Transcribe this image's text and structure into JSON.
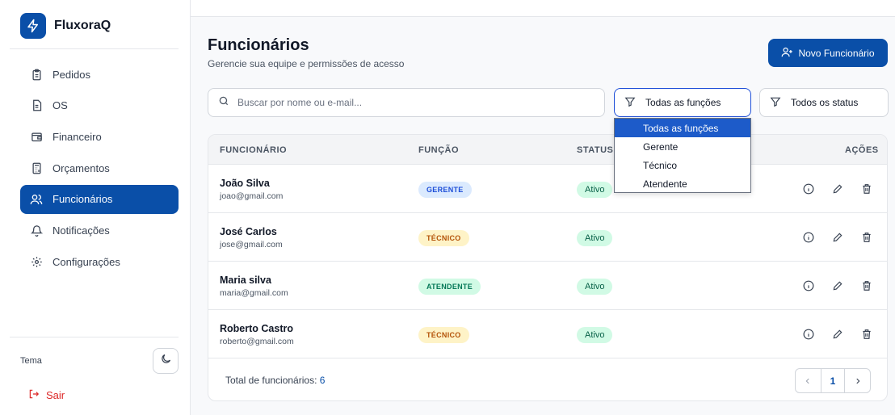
{
  "brand": {
    "name": "FluxoraQ"
  },
  "sidebar": {
    "items": [
      {
        "label": "Pedidos",
        "icon": "clipboard-icon",
        "active": false
      },
      {
        "label": "OS",
        "icon": "document-icon",
        "active": false
      },
      {
        "label": "Financeiro",
        "icon": "wallet-icon",
        "active": false
      },
      {
        "label": "Orçamentos",
        "icon": "calculator-icon",
        "active": false
      },
      {
        "label": "Funcionários",
        "icon": "users-icon",
        "active": true
      },
      {
        "label": "Notificações",
        "icon": "bell-icon",
        "active": false
      },
      {
        "label": "Configurações",
        "icon": "gear-icon",
        "active": false
      }
    ],
    "theme_label": "Tema",
    "logout_label": "Sair"
  },
  "header": {
    "title": "Funcionários",
    "subtitle": "Gerencie sua equipe e permissões de acesso",
    "new_button": "Novo Funcionário"
  },
  "filters": {
    "search_placeholder": "Buscar por nome ou e-mail...",
    "function_filter": "Todas as funções",
    "status_filter": "Todos os status"
  },
  "dropdown": {
    "options": [
      "Todas as funções",
      "Gerente",
      "Técnico",
      "Atendente"
    ],
    "selected_index": 0
  },
  "table": {
    "columns": [
      "FUNCIONÁRIO",
      "FUNÇÃO",
      "STATUS",
      "AÇÕES"
    ],
    "rows": [
      {
        "name": "João Silva",
        "email": "joao@gmail.com",
        "role": "GERENTE",
        "status": "Ativo"
      },
      {
        "name": "José Carlos",
        "email": "jose@gmail.com",
        "role": "TÉCNICO",
        "status": "Ativo"
      },
      {
        "name": "Maria silva",
        "email": "maria@gmail.com",
        "role": "ATENDENTE",
        "status": "Ativo"
      },
      {
        "name": "Roberto Castro",
        "email": "roberto@gmail.com",
        "role": "TÉCNICO",
        "status": "Ativo"
      }
    ]
  },
  "footer": {
    "total_label": "Total de funcionários:",
    "total_count": "6",
    "current_page": "1"
  },
  "colors": {
    "primary": "#0a4fa8",
    "danger": "#dc2626"
  }
}
